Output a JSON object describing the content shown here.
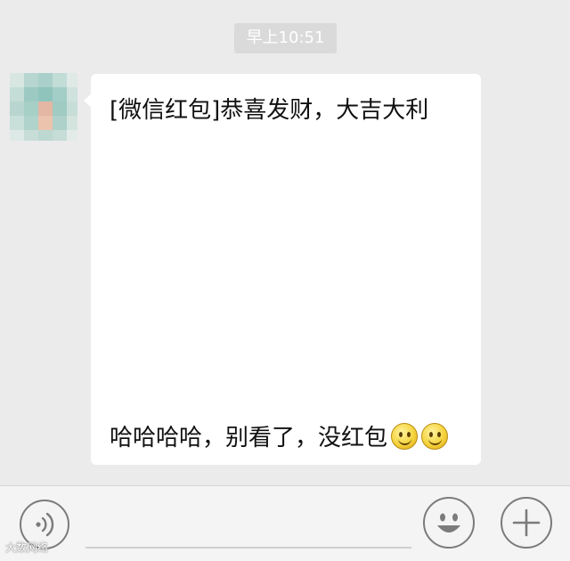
{
  "chat": {
    "timestamp": "早上10:51",
    "message": {
      "line1": "[微信红包]恭喜发财，大吉大利",
      "line2": "哈哈哈哈，别看了，没红包",
      "emojis": [
        "smile-emoji",
        "smile-emoji"
      ]
    }
  },
  "input_bar": {
    "voice_icon": "voice-icon",
    "emoji_icon": "smiley-icon",
    "plus_icon": "plus-icon"
  },
  "watermark": "大数网络",
  "colors": {
    "background": "#ebebeb",
    "bubble": "#ffffff",
    "timestamp_bg": "#dadada",
    "input_bar": "#f4f4f4",
    "icon_stroke": "#7b7b7b"
  }
}
